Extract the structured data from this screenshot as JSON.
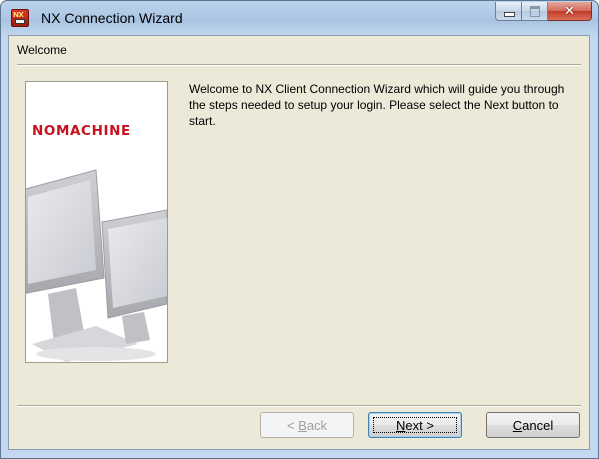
{
  "window": {
    "title": "NX Connection Wizard"
  },
  "page": {
    "title": "Welcome",
    "welcome_text": "Welcome to NX Client Connection Wizard which will guide you through the steps needed to setup your login. Please select the Next button to start.",
    "logo_text": "NOMACHINE"
  },
  "buttons": {
    "back": {
      "before": "< ",
      "mnemonic": "B",
      "after": "ack"
    },
    "next": {
      "before": "",
      "mnemonic": "N",
      "after": "ext >"
    },
    "cancel": {
      "before": "",
      "mnemonic": "C",
      "after": "ancel"
    }
  },
  "colors": {
    "dialog_background": "#ece9d8",
    "logo_red": "#c8101e",
    "titlebar_blue": "#bcd3ec",
    "close_button_red": "#c13b27"
  },
  "icons": [
    "nx-app-icon",
    "minimize-icon",
    "maximize-icon",
    "close-icon"
  ]
}
